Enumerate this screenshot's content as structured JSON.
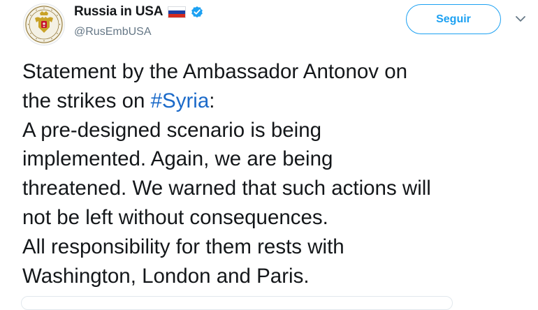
{
  "author": {
    "display_name": "Russia in USA",
    "handle": "@RusEmbUSA",
    "flag_icon": "russia-flag-icon",
    "verified_icon": "verified-badge-icon",
    "verified_color": "#1da1f2"
  },
  "actions": {
    "follow_label": "Seguir",
    "menu_icon": "chevron-down-icon"
  },
  "tweet": {
    "line1": "Statement by the Ambassador Antonov on",
    "line2_prefix": "the strikes on ",
    "hashtag": "#Syria",
    "line2_suffix": ":",
    "line3": "A pre-designed scenario is being",
    "line4": "implemented. Again, we are being",
    "line5": "threatened. We warned that such actions will",
    "line6": "not be left without consequences.",
    "line7": "All responsibility for them rests with",
    "line8": "Washington, London and Paris."
  },
  "colors": {
    "link": "#1b6ac9",
    "accent": "#1da1f2",
    "secondary_text": "#657786"
  }
}
